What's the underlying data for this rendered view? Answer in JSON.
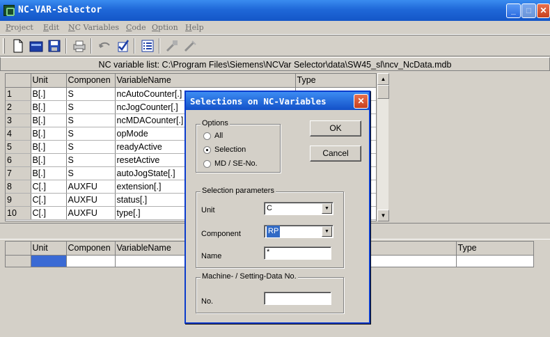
{
  "window": {
    "title": "NC-VAR-Selector"
  },
  "menu": [
    "Project",
    "Edit",
    "NC Variables",
    "Code",
    "Option",
    "Help"
  ],
  "toolbar": {
    "icons": [
      "new-file-icon",
      "open-folder-icon",
      "save-disk-icon",
      "print-icon",
      "undo-icon",
      "check-selection-icon",
      "list-icon",
      "variables-icon",
      "edit-variables-icon"
    ]
  },
  "caption": "NC variable list:  C:\\Program Files\\Siemens\\NCVar Selector\\data\\SW45_sl\\ncv_NcData.mdb",
  "top_table": {
    "headers": [
      "Unit",
      "Componen",
      "VariableName",
      "Type"
    ],
    "rows": [
      [
        "1",
        "B[.]",
        "S",
        "ncAutoCounter[.]"
      ],
      [
        "2",
        "B[.]",
        "S",
        "ncJogCounter[.]"
      ],
      [
        "3",
        "B[.]",
        "S",
        "ncMDACounter[.]"
      ],
      [
        "4",
        "B[.]",
        "S",
        "opMode"
      ],
      [
        "5",
        "B[.]",
        "S",
        "readyActive"
      ],
      [
        "6",
        "B[.]",
        "S",
        "resetActive"
      ],
      [
        "7",
        "B[.]",
        "S",
        "autoJogState[.]"
      ],
      [
        "8",
        "C[.]",
        "AUXFU",
        "extension[.]"
      ],
      [
        "9",
        "C[.]",
        "AUXFU",
        "status[.]"
      ],
      [
        "10",
        "C[.]",
        "AUXFU",
        "type[.]"
      ]
    ]
  },
  "bottom_table": {
    "headers": [
      "Unit",
      "Componen",
      "VariableName",
      "Type"
    ]
  },
  "dialog": {
    "title": "Selections on NC-Variables",
    "options_label": "Options",
    "options": [
      "All",
      "Selection",
      "MD / SE-No."
    ],
    "selected_option": 1,
    "ok_label": "OK",
    "cancel_label": "Cancel",
    "params_label": "Selection parameters",
    "unit_label": "Unit",
    "unit_value": "C",
    "component_label": "Component",
    "component_value": "RP",
    "name_label": "Name",
    "name_value": "*",
    "md_group_label": "Machine- / Setting-Data No.",
    "no_label": "No.",
    "no_value": ""
  }
}
